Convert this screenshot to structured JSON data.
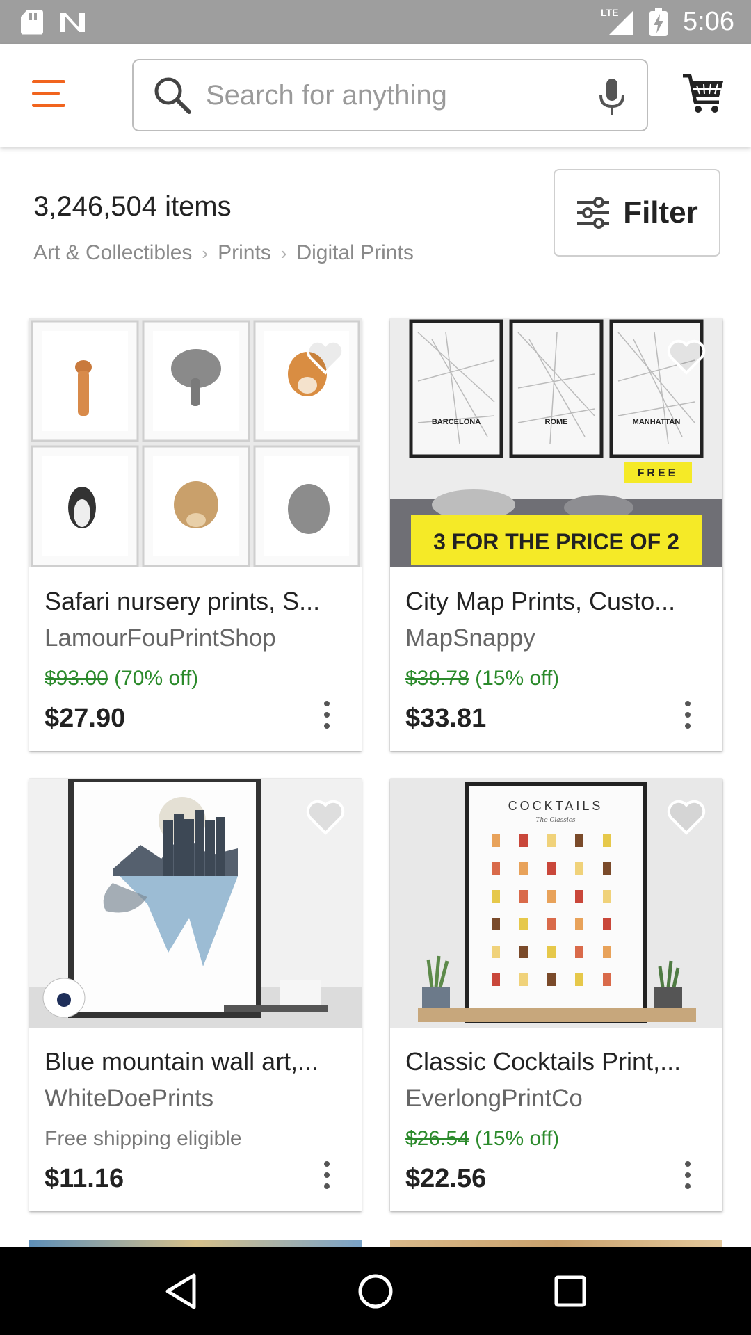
{
  "status_bar": {
    "time": "5:06",
    "network_label": "LTE",
    "icons": [
      "sd-card-icon",
      "no-sim-icon",
      "lte-signal-icon",
      "battery-charging-icon"
    ]
  },
  "app_bar": {
    "search_placeholder": "Search for anything",
    "accent_color": "#f1641e",
    "icons": [
      "menu-icon",
      "search-icon",
      "microphone-icon",
      "cart-icon"
    ]
  },
  "results": {
    "count": "3,246,504 items",
    "breadcrumb": [
      "Art & Collectibles",
      "Prints",
      "Digital Prints"
    ],
    "filter_label": "Filter"
  },
  "listings": [
    {
      "title": "Safari nursery prints, S...",
      "shop": "LamourFouPrintShop",
      "original_price": "$93.00",
      "discount": "(70% off)",
      "price": "$27.90",
      "image": "safari-animal-prints-image"
    },
    {
      "title": "City Map Prints, Custo...",
      "shop": "MapSnappy",
      "original_price": "$39.78",
      "discount": "(15% off)",
      "price": "$33.81",
      "image": "city-map-prints-image",
      "image_text": {
        "map1": "BARCELONA",
        "map2": "ROME",
        "map3": "MANHATTAN",
        "tag": "FREE",
        "banner": "3 FOR THE PRICE OF 2"
      }
    },
    {
      "title": "Blue mountain wall art,...",
      "shop": "WhiteDoePrints",
      "shipping": "Free shipping eligible",
      "price": "$11.16",
      "image": "blue-mountain-art-image"
    },
    {
      "title": "Classic Cocktails Print,...",
      "shop": "EverlongPrintCo",
      "original_price": "$26.54",
      "discount": "(15% off)",
      "price": "$22.56",
      "image": "cocktails-poster-image",
      "image_text": {
        "poster_title": "COCKTAILS",
        "poster_subtitle": "The Classics"
      }
    }
  ],
  "nav_bar": {
    "icons": [
      "back-icon",
      "home-icon",
      "recents-icon"
    ]
  }
}
